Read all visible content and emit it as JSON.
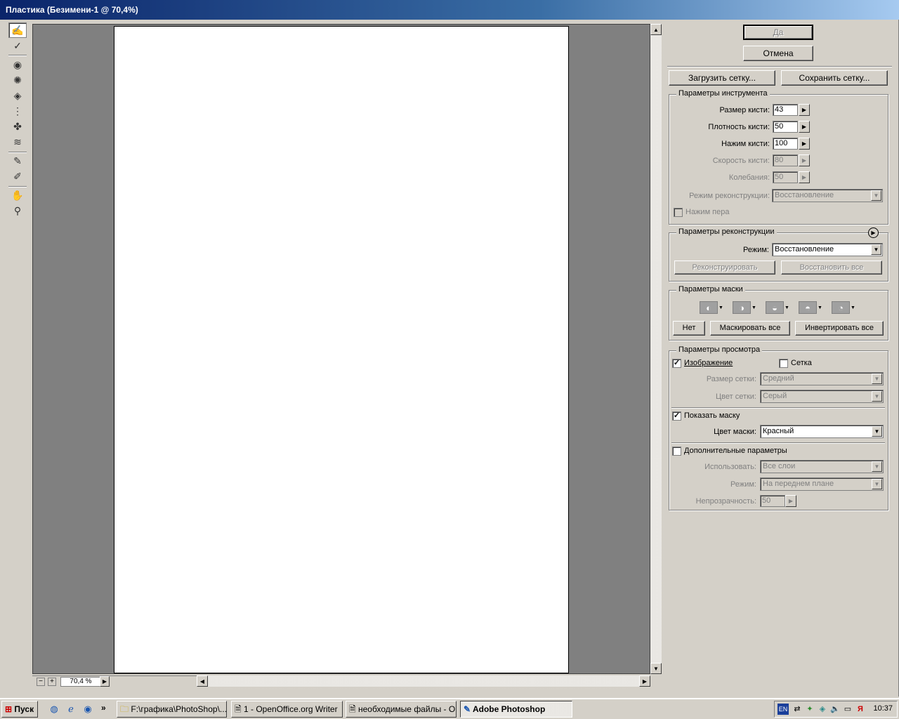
{
  "window": {
    "title": "Пластика (Безимени-1 @ 70,4%)"
  },
  "toolbar": {
    "tools": [
      {
        "name": "forward-warp-tool-icon",
        "glyph": "✍",
        "active": true
      },
      {
        "name": "reconstruct-tool-icon",
        "glyph": "✓"
      },
      {
        "name": "twirl-tool-icon",
        "glyph": "◉"
      },
      {
        "name": "pucker-tool-icon",
        "glyph": "✺"
      },
      {
        "name": "bloat-tool-icon",
        "glyph": "◈"
      },
      {
        "name": "push-left-tool-icon",
        "glyph": "⋮"
      },
      {
        "name": "mirror-tool-icon",
        "glyph": "✤"
      },
      {
        "name": "turbulence-tool-icon",
        "glyph": "≋"
      },
      {
        "name": "freeze-mask-tool-icon",
        "glyph": "✎"
      },
      {
        "name": "thaw-mask-tool-icon",
        "glyph": "✐"
      },
      {
        "name": "hand-tool-icon",
        "glyph": "✋"
      },
      {
        "name": "zoom-tool-icon",
        "glyph": "⚲"
      }
    ]
  },
  "canvas": {
    "zoom": "70,4 %"
  },
  "buttons": {
    "ok": "Да",
    "cancel": "Отмена",
    "load_mesh": "Загрузить сетку...",
    "save_mesh": "Сохранить сетку..."
  },
  "tool_options": {
    "title": "Параметры инструмента",
    "brush_size_label": "Размер кисти:",
    "brush_size": "43",
    "brush_density_label": "Плотность кисти:",
    "brush_density": "50",
    "brush_pressure_label": "Нажим кисти:",
    "brush_pressure": "100",
    "brush_rate_label": "Скорость кисти:",
    "brush_rate": "80",
    "turbulent_jitter_label": "Колебания:",
    "turbulent_jitter": "50",
    "reconstruct_mode_label": "Режим реконструкции:",
    "reconstruct_mode": "Восстановление",
    "stylus_pressure_label": "Нажим пера"
  },
  "reconstruct_options": {
    "title": "Параметры реконструкции",
    "mode_label": "Режим:",
    "mode": "Восстановление",
    "reconstruct_button": "Реконструировать",
    "restore_all_button": "Восстановить все"
  },
  "mask_options": {
    "title": "Параметры маски",
    "none_button": "Нет",
    "mask_all_button": "Маскировать все",
    "invert_all_button": "Инвертировать все"
  },
  "view_options": {
    "title": "Параметры просмотра",
    "show_image_label": "Изображение",
    "show_image": true,
    "show_mesh_label": "Сетка",
    "show_mesh": false,
    "mesh_size_label": "Размер сетки:",
    "mesh_size": "Средний",
    "mesh_color_label": "Цвет сетки:",
    "mesh_color": "Серый",
    "show_mask_label": "Показать маску",
    "show_mask": true,
    "mask_color_label": "Цвет маски:",
    "mask_color": "Красный",
    "show_backdrop_label": "Дополнительные параметры",
    "show_backdrop": false,
    "use_label": "Использовать:",
    "use_value": "Все слои",
    "mode_label": "Режим:",
    "mode_value": "На переднем плане",
    "opacity_label": "Непрозрачность:",
    "opacity_value": "50"
  },
  "taskbar": {
    "start": "Пуск",
    "more": "»",
    "items": [
      {
        "label": "F:\\графика\\PhotoShop\\...",
        "active": false
      },
      {
        "label": "1 - OpenOffice.org Writer",
        "active": false
      },
      {
        "label": "необходимые файлы - О...",
        "active": false
      },
      {
        "label": "Adobe Photoshop",
        "active": true
      }
    ],
    "lang": "EN",
    "clock": "10:37"
  },
  "colors": {
    "title_start": "#0a246a",
    "title_end": "#a6caf0",
    "canvas_bg": "#808080",
    "face": "#d4d0c8"
  }
}
